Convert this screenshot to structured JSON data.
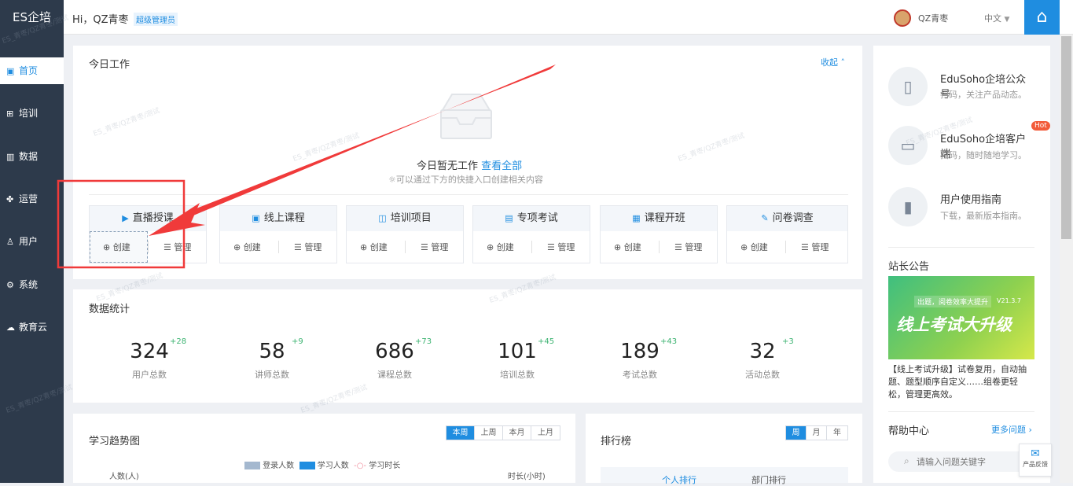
{
  "app": {
    "logo": "ES企培"
  },
  "sidebar": {
    "items": [
      {
        "label": "首页",
        "icon": "dashboard-icon"
      },
      {
        "label": "培训",
        "icon": "training-icon"
      },
      {
        "label": "数据",
        "icon": "chart-icon"
      },
      {
        "label": "运营",
        "icon": "operation-icon"
      },
      {
        "label": "用户",
        "icon": "user-icon"
      },
      {
        "label": "系统",
        "icon": "gear-icon"
      },
      {
        "label": "教育云",
        "icon": "cloud-icon"
      }
    ]
  },
  "header": {
    "greeting": "Hi，QZ青枣",
    "role_badge": "超级管理员",
    "username": "QZ青枣",
    "language": "中文"
  },
  "watermark": "ES_青枣/QZ青枣/测试",
  "today": {
    "title": "今日工作",
    "collapse": "收起",
    "empty_text": "今日暂无工作",
    "view_all": "查看全部",
    "hint": "可以通过下方的快捷入口创建相关内容",
    "create_label": "创建",
    "manage_label": "管理",
    "quick": [
      {
        "title": "直播授课"
      },
      {
        "title": "线上课程"
      },
      {
        "title": "培训项目"
      },
      {
        "title": "专项考试"
      },
      {
        "title": "课程开班"
      },
      {
        "title": "问卷调查"
      }
    ]
  },
  "stats": {
    "title": "数据统计",
    "items": [
      {
        "value": "324",
        "inc": "+28",
        "label": "用户总数"
      },
      {
        "value": "58",
        "inc": "+9",
        "label": "讲师总数"
      },
      {
        "value": "686",
        "inc": "+73",
        "label": "课程总数"
      },
      {
        "value": "101",
        "inc": "+45",
        "label": "培训总数"
      },
      {
        "value": "189",
        "inc": "+43",
        "label": "考试总数"
      },
      {
        "value": "32",
        "inc": "+3",
        "label": "活动总数"
      }
    ]
  },
  "trend": {
    "title": "学习趋势图",
    "tabs": [
      "本周",
      "上周",
      "本月",
      "上月"
    ],
    "legend": [
      "登录人数",
      "学习人数",
      "学习时长"
    ],
    "y_left": "人数(人)",
    "y_right": "时长(小时)"
  },
  "ranking": {
    "title": "排行榜",
    "tabs": [
      "周",
      "月",
      "年"
    ],
    "subtabs": [
      "个人排行",
      "部门排行"
    ]
  },
  "right": {
    "cards": [
      {
        "title": "EduSoho企培公众号",
        "sub": "扫码，关注产品动态。",
        "icon": "phone-icon"
      },
      {
        "title": "EduSoho企培客户端",
        "sub": "扫码，随时随地学习。",
        "icon": "devices-icon",
        "hot": "Hot"
      },
      {
        "title": "用户使用指南",
        "sub": "下载，最新版本指南。",
        "icon": "book-icon"
      }
    ],
    "notice_title": "站长公告",
    "banner_small": "出题，阅卷效率大提升",
    "banner_version": "V21.3.7",
    "banner_big": "线上考试大升级",
    "notice_text": "【线上考试升级】试卷复用，自动抽题、题型顺序自定义……组卷更轻松，管理更高效。",
    "help_title": "帮助中心",
    "more": "更多问题",
    "search_placeholder": "请输入问题关键字",
    "feedback": "产品反馈"
  }
}
